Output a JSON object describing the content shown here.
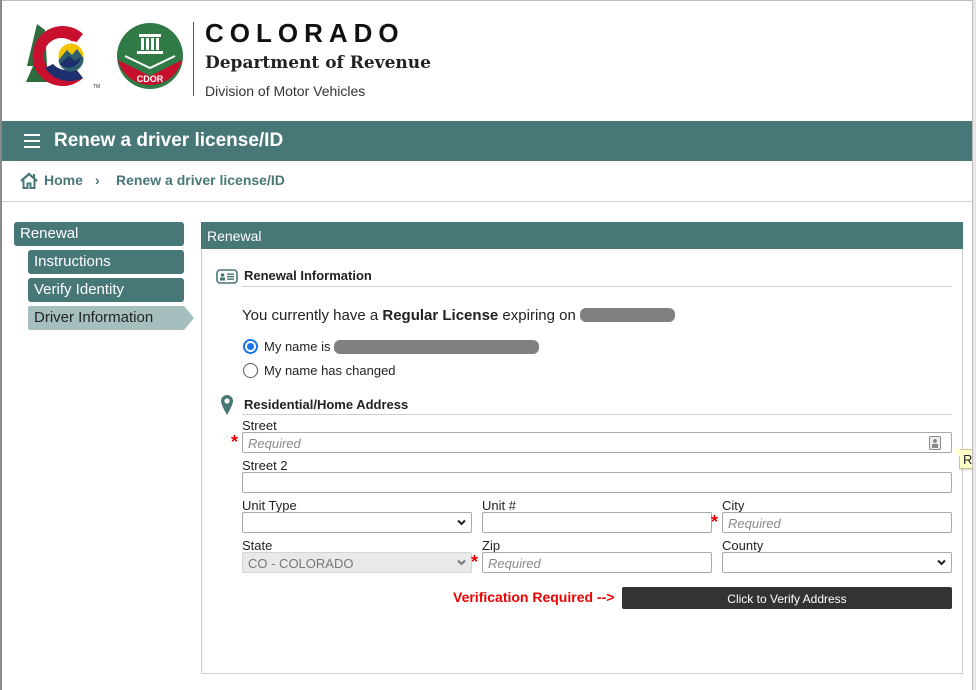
{
  "header": {
    "brand_title": "COLORADO",
    "brand_department": "Department of Revenue",
    "brand_division": "Division of Motor Vehicles",
    "cdor_badge": "CDOR",
    "trademark": "TM"
  },
  "titlebar": {
    "menu_icon": "hamburger-icon",
    "title": "Renew a driver license/ID"
  },
  "breadcrumb": {
    "home_icon": "home-icon",
    "home": "Home",
    "separator": "›",
    "current": "Renew a driver license/ID"
  },
  "sidebar": {
    "main": "Renewal",
    "items": [
      {
        "label": "Instructions",
        "state": "completed"
      },
      {
        "label": "Verify Identity",
        "state": "completed"
      },
      {
        "label": "Driver Information",
        "state": "active"
      }
    ]
  },
  "panel": {
    "title": "Renewal",
    "renewal_info": {
      "icon": "id-card-icon",
      "title": "Renewal Information",
      "license_prefix": "You currently have a ",
      "license_type": "Regular License",
      "license_suffix": " expiring on ",
      "expiry_redacted": true,
      "radios": [
        {
          "label": "My name is ",
          "checked": true,
          "redacted_value": true
        },
        {
          "label": "My name has changed",
          "checked": false
        }
      ]
    },
    "address": {
      "icon": "map-pin-icon",
      "title": "Residential/Home Address",
      "fields": {
        "street": {
          "label": "Street",
          "placeholder": "Required",
          "value": "",
          "required": true
        },
        "street2": {
          "label": "Street 2",
          "placeholder": "",
          "value": ""
        },
        "unit_type": {
          "label": "Unit Type",
          "value": ""
        },
        "unit_number": {
          "label": "Unit #",
          "placeholder": "",
          "value": ""
        },
        "city": {
          "label": "City",
          "placeholder": "Required",
          "value": "",
          "required": true
        },
        "state": {
          "label": "State",
          "value": "CO - COLORADO",
          "disabled": true
        },
        "zip": {
          "label": "Zip",
          "placeholder": "Required",
          "value": "",
          "required": true
        },
        "county": {
          "label": "County",
          "value": ""
        }
      },
      "required_marker": "*",
      "tooltip": "Re",
      "verification_label": "Verification Required -->",
      "verify_button": "Click to Verify Address"
    }
  },
  "colors": {
    "brand_teal": "#477776",
    "active_step": "#a5bfbf",
    "required_red": "#ee0000",
    "button_dark": "#333333",
    "radio_blue": "#1a73e8"
  }
}
